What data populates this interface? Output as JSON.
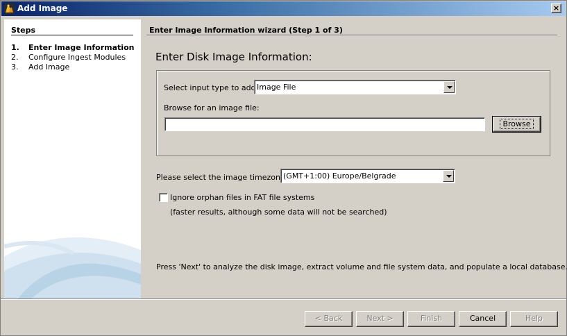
{
  "window": {
    "title": "Add Image",
    "close_glyph": "×"
  },
  "steps": {
    "heading": "Steps",
    "items": [
      {
        "num": "1.",
        "label": "Enter Image Information",
        "active": true
      },
      {
        "num": "2.",
        "label": "Configure Ingest Modules",
        "active": false
      },
      {
        "num": "3.",
        "label": "Add Image",
        "active": false
      }
    ]
  },
  "wizard": {
    "header": "Enter Image Information wizard (Step 1 of 3)",
    "section_title": "Enter Disk Image Information:",
    "input_type_label": "Select input type to add:",
    "input_type_value": "Image File",
    "browse_label": "Browse for an image file:",
    "image_path_value": "",
    "browse_button": "Browse",
    "timezone_label": "Please select the image timezone:",
    "timezone_value": "(GMT+1:00) Europe/Belgrade",
    "ignore_orphan_label": "Ignore orphan files in FAT file systems",
    "ignore_orphan_checked": false,
    "ignore_orphan_note": "(faster results, although some data will not be searched)",
    "next_hint": "Press 'Next' to analyze the disk image, extract volume and file system data, and populate a local database."
  },
  "footer": {
    "back": "< Back",
    "next": "Next >",
    "finish": "Finish",
    "cancel": "Cancel",
    "help": "Help"
  },
  "colors": {
    "title_bar_start": "#0a246a",
    "title_bar_end": "#a6caf0",
    "dialog_bg": "#d4d0c8",
    "panel_bg": "#ffffff"
  }
}
